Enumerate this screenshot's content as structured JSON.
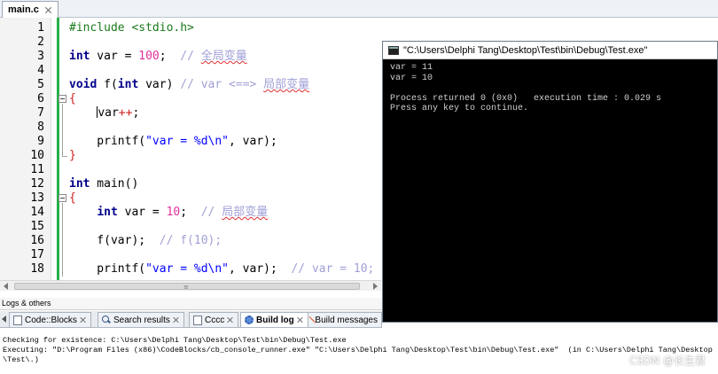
{
  "editor_tab": {
    "label": "main.c"
  },
  "editor": {
    "lines": [
      {
        "n": "1",
        "tokens": [
          {
            "t": "#include <stdio.h>",
            "c": "pp"
          }
        ]
      },
      {
        "n": "2",
        "tokens": []
      },
      {
        "n": "3",
        "tokens": [
          {
            "t": "int",
            "c": "kw"
          },
          {
            "t": " var = ",
            "c": ""
          },
          {
            "t": "100",
            "c": "num"
          },
          {
            "t": ";  ",
            "c": ""
          },
          {
            "t": "// ",
            "c": "cm"
          },
          {
            "t": "全局变量",
            "c": "cm sq"
          }
        ]
      },
      {
        "n": "4",
        "tokens": []
      },
      {
        "n": "5",
        "tokens": [
          {
            "t": "void",
            "c": "kw"
          },
          {
            "t": " f(",
            "c": ""
          },
          {
            "t": "int",
            "c": "kw"
          },
          {
            "t": " var) ",
            "c": ""
          },
          {
            "t": "// var <==> ",
            "c": "cm"
          },
          {
            "t": "局部变量",
            "c": "cm sq"
          }
        ]
      },
      {
        "n": "6",
        "tokens": [
          {
            "t": "{",
            "c": "op"
          }
        ],
        "fold": "open"
      },
      {
        "n": "7",
        "tokens": [
          {
            "t": "    ",
            "c": ""
          },
          {
            "t": "CARET",
            "c": "caret"
          },
          {
            "t": "var",
            "c": ""
          },
          {
            "t": "++",
            "c": "op"
          },
          {
            "t": ";",
            "c": ""
          }
        ]
      },
      {
        "n": "8",
        "tokens": []
      },
      {
        "n": "9",
        "tokens": [
          {
            "t": "    printf(",
            "c": ""
          },
          {
            "t": "\"var = %d\\n\"",
            "c": "str"
          },
          {
            "t": ", var);",
            "c": ""
          }
        ]
      },
      {
        "n": "10",
        "tokens": [
          {
            "t": "}",
            "c": "op"
          }
        ],
        "fold": "end"
      },
      {
        "n": "11",
        "tokens": []
      },
      {
        "n": "12",
        "tokens": [
          {
            "t": "int",
            "c": "kw"
          },
          {
            "t": " main()",
            "c": ""
          }
        ]
      },
      {
        "n": "13",
        "tokens": [
          {
            "t": "{",
            "c": "op"
          }
        ],
        "fold": "open"
      },
      {
        "n": "14",
        "tokens": [
          {
            "t": "    ",
            "c": ""
          },
          {
            "t": "int",
            "c": "kw"
          },
          {
            "t": " var = ",
            "c": ""
          },
          {
            "t": "10",
            "c": "num"
          },
          {
            "t": ";  ",
            "c": ""
          },
          {
            "t": "// ",
            "c": "cm"
          },
          {
            "t": "局部变量",
            "c": "cm sq"
          }
        ]
      },
      {
        "n": "15",
        "tokens": []
      },
      {
        "n": "16",
        "tokens": [
          {
            "t": "    f(var);  ",
            "c": ""
          },
          {
            "t": "// f(10);",
            "c": "cm"
          }
        ]
      },
      {
        "n": "17",
        "tokens": []
      },
      {
        "n": "18",
        "tokens": [
          {
            "t": "    printf(",
            "c": ""
          },
          {
            "t": "\"var = %d\\n\"",
            "c": "str"
          },
          {
            "t": ", var);  ",
            "c": ""
          },
          {
            "t": "// var = 10;",
            "c": "cm"
          }
        ]
      }
    ]
  },
  "scrollbar": {
    "grip": "≡"
  },
  "console": {
    "title": "\"C:\\Users\\Delphi Tang\\Desktop\\Test\\bin\\Debug\\Test.exe\"",
    "output": [
      "var = 11",
      "var = 10",
      "",
      "Process returned 0 (0x0)   execution time : 0.029 s",
      "Press any key to continue."
    ]
  },
  "logs": {
    "title": "Logs & others",
    "tabs": [
      {
        "label": "Code::Blocks",
        "icon": "document-icon"
      },
      {
        "label": "Search results",
        "icon": "search-icon"
      },
      {
        "label": "Cccc",
        "icon": "document-icon"
      },
      {
        "label": "Build log",
        "icon": "gear-icon",
        "active": true
      },
      {
        "label": "Build messages",
        "icon": "pin-icon"
      }
    ],
    "lines": [
      "Checking for existence: C:\\Users\\Delphi Tang\\Desktop\\Test\\bin\\Debug\\Test.exe",
      "Executing: \"D:\\Program Files (x86)\\CodeBlocks/cb_console_runner.exe\" \"C:\\Users\\Delphi Tang\\Desktop\\Test\\bin\\Debug\\Test.exe\"  (in C:\\Users\\Delphi Tang\\Desktop",
      "\\Test\\.)"
    ]
  },
  "watermark": "CSDN @长生君"
}
